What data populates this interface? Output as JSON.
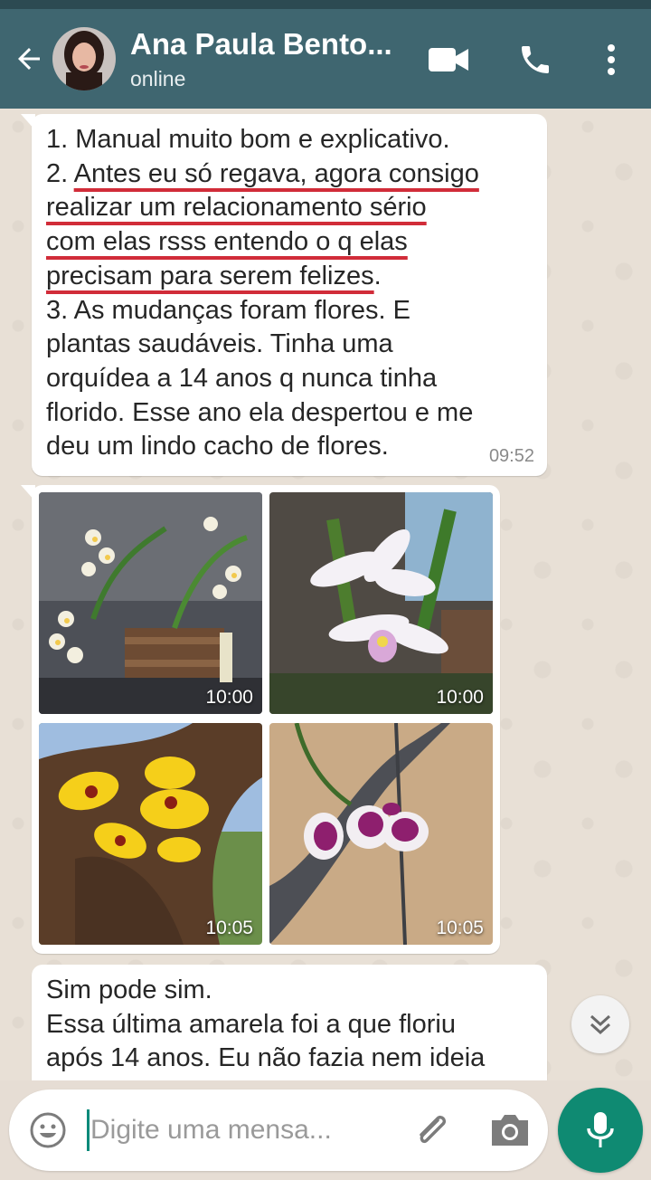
{
  "header": {
    "contact_name": "Ana Paula Bento...",
    "status": "online"
  },
  "messages": {
    "m1": {
      "lines": [
        {
          "pre": "1. Manual muito bom e explicativo.",
          "ul": "",
          "post": ""
        },
        {
          "pre": "2. ",
          "ul": "Antes eu só regava, agora consigo",
          "post": ""
        },
        {
          "pre": "",
          "ul": "realizar um relacionamento sério",
          "post": ""
        },
        {
          "pre": "",
          "ul": "com elas rsss entendo o q elas",
          "post": ""
        },
        {
          "pre": "",
          "ul": "precisam para serem felizes",
          "post": "."
        },
        {
          "pre": "3. As mudanças foram flores. E",
          "ul": "",
          "post": ""
        },
        {
          "pre": "plantas saudáveis. Tinha uma",
          "ul": "",
          "post": ""
        },
        {
          "pre": "orquídea a 14 anos q nunca tinha",
          "ul": "",
          "post": ""
        },
        {
          "pre": "florido. Esse ano ela despertou e me",
          "ul": "",
          "post": ""
        },
        {
          "pre": "deu um lindo cacho de flores.",
          "ul": "",
          "post": ""
        }
      ],
      "time": "09:52"
    },
    "photos": [
      {
        "time": "10:00",
        "subject": "white orchids in wooden crate"
      },
      {
        "time": "10:00",
        "subject": "white orchid cattleya"
      },
      {
        "time": "10:05",
        "subject": "yellow orchid on tree"
      },
      {
        "time": "10:05",
        "subject": "purple white orchid"
      }
    ],
    "m3": {
      "lines": [
        "Sim pode sim.",
        "Essa última amarela foi a que floriu",
        "após 14 anos. Eu não fazia nem ideia"
      ]
    }
  },
  "composer": {
    "placeholder": "Digite uma mensa..."
  },
  "icons": {
    "back": "arrow-back-icon",
    "video": "video-call-icon",
    "call": "phone-icon",
    "menu": "more-vert-icon",
    "emoji": "emoji-icon",
    "attach": "paperclip-icon",
    "camera": "camera-icon",
    "mic": "mic-icon",
    "scroll": "double-chevron-down-icon"
  },
  "colors": {
    "header": "#3f6670",
    "accent": "#0f8a72",
    "underline": "#d12c39"
  }
}
